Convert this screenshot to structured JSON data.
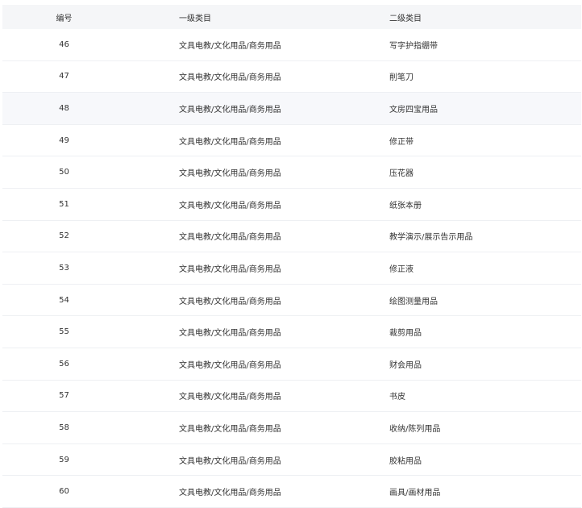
{
  "table": {
    "headers": {
      "id": "编号",
      "level1": "一级类目",
      "level2": "二级类目"
    },
    "rows": [
      {
        "id": "46",
        "level1": "文具电教/文化用品/商务用品",
        "level2": "写字护指绷带"
      },
      {
        "id": "47",
        "level1": "文具电教/文化用品/商务用品",
        "level2": "削笔刀"
      },
      {
        "id": "48",
        "level1": "文具电教/文化用品/商务用品",
        "level2": "文房四宝用品"
      },
      {
        "id": "49",
        "level1": "文具电教/文化用品/商务用品",
        "level2": "修正带"
      },
      {
        "id": "50",
        "level1": "文具电教/文化用品/商务用品",
        "level2": "压花器"
      },
      {
        "id": "51",
        "level1": "文具电教/文化用品/商务用品",
        "level2": "纸张本册"
      },
      {
        "id": "52",
        "level1": "文具电教/文化用品/商务用品",
        "level2": "教学演示/展示告示用品"
      },
      {
        "id": "53",
        "level1": "文具电教/文化用品/商务用品",
        "level2": "修正液"
      },
      {
        "id": "54",
        "level1": "文具电教/文化用品/商务用品",
        "level2": "绘图测量用品"
      },
      {
        "id": "55",
        "level1": "文具电教/文化用品/商务用品",
        "level2": "裁剪用品"
      },
      {
        "id": "56",
        "level1": "文具电教/文化用品/商务用品",
        "level2": "财会用品"
      },
      {
        "id": "57",
        "level1": "文具电教/文化用品/商务用品",
        "level2": "书皮"
      },
      {
        "id": "58",
        "level1": "文具电教/文化用品/商务用品",
        "level2": "收纳/陈列用品"
      },
      {
        "id": "59",
        "level1": "文具电教/文化用品/商务用品",
        "level2": "胶粘用品"
      },
      {
        "id": "60",
        "level1": "文具电教/文化用品/商务用品",
        "level2": "画具/画材用品"
      }
    ]
  }
}
